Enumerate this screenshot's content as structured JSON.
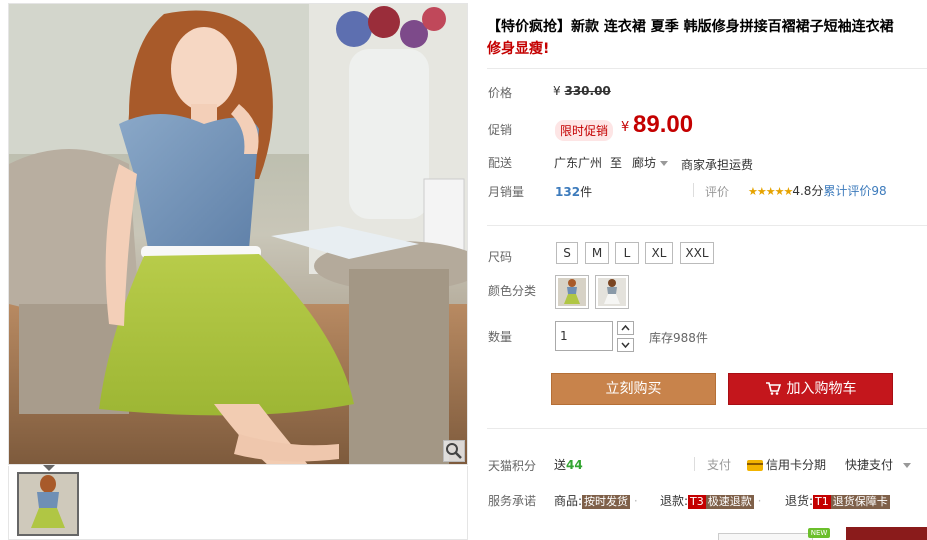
{
  "product": {
    "title_prefix": "【特价疯抢】新款 连衣裙 夏季 韩版修身拼接百褶裙子短袖连衣裙",
    "title_promo": "修身显瘦!"
  },
  "price": {
    "label": "价格",
    "currency": "¥",
    "original": "330.00"
  },
  "promo": {
    "label": "促销",
    "badge": "限时促销",
    "currency": "¥",
    "price": "89.00"
  },
  "delivery": {
    "label": "配送",
    "origin": "广东广州",
    "to": "至",
    "destination": "廊坊",
    "shipping_note": "商家承担运费"
  },
  "sales": {
    "label": "月销量",
    "count": "132",
    "unit": "件",
    "rating_label": "评价",
    "stars": "★★★★★",
    "score": "4.8分",
    "cumulative": "累计评价98"
  },
  "size": {
    "label": "尺码",
    "options": [
      "S",
      "M",
      "L",
      "XL",
      "XXL"
    ]
  },
  "color": {
    "label": "颜色分类",
    "swatches": [
      "blue-green-dress",
      "white-dress"
    ]
  },
  "quantity": {
    "label": "数量",
    "value": "1",
    "stock": "库存988件"
  },
  "actions": {
    "buy_now": "立刻购买",
    "add_to_cart": "加入购物车"
  },
  "points": {
    "label": "天猫积分",
    "prefix": "送",
    "value": "44",
    "pay_label": "支付",
    "credit_card": "信用卡分期",
    "quick_pay": "快捷支付"
  },
  "service": {
    "label": "服务承诺",
    "goods_prefix": "商品:",
    "goods_tag": "按时发货",
    "refund_prefix": "退款:",
    "refund_code": "T3",
    "refund_tag": "极速退款",
    "return_prefix": "退货:",
    "return_code": "T1",
    "return_tag": "退货保障卡"
  },
  "misc": {
    "new_badge": "NEW"
  },
  "colors": {
    "accent_red": "#c40000",
    "buy_button": "#c8834b",
    "cart_button": "#c4161c"
  }
}
